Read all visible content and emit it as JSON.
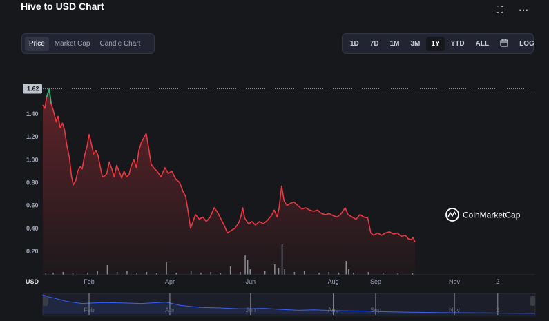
{
  "header": {
    "title": "Hive to USD Chart",
    "fullscreen_icon": "expand-icon",
    "more_icon": "more-horizontal-icon"
  },
  "view_tabs": [
    {
      "label": "Price",
      "active": true
    },
    {
      "label": "Market Cap",
      "active": false
    },
    {
      "label": "Candle Chart",
      "active": false
    }
  ],
  "range_tabs": [
    {
      "label": "1D",
      "active": false
    },
    {
      "label": "7D",
      "active": false
    },
    {
      "label": "1M",
      "active": false
    },
    {
      "label": "3M",
      "active": false
    },
    {
      "label": "1Y",
      "active": true
    },
    {
      "label": "YTD",
      "active": false
    },
    {
      "label": "ALL",
      "active": false
    },
    {
      "label": "",
      "icon": "calendar-icon",
      "active": false
    },
    {
      "label": "LOG",
      "active": false
    }
  ],
  "watermark": "CoinMarketCap",
  "colors": {
    "line": "#ea3943",
    "up_segment": "#16c784",
    "volume": "#8a8d94",
    "navigator": "#3861fb",
    "background": "#17181b"
  },
  "chart_data": {
    "type": "line",
    "unit_label": "USD",
    "ylim": [
      0,
      1.7
    ],
    "yticks": [
      0.2,
      0.4,
      0.6,
      0.8,
      1.0,
      1.2,
      1.4
    ],
    "ytick_labels": [
      "0.20",
      "0.40",
      "0.60",
      "0.80",
      "1.00",
      "1.20",
      "1.40"
    ],
    "current_price_label": "1.62",
    "current_price": 1.62,
    "xlim": [
      0,
      1
    ],
    "xticks": [
      {
        "pos": 0.094,
        "label": "Feb"
      },
      {
        "pos": 0.258,
        "label": "Apr"
      },
      {
        "pos": 0.422,
        "label": "Jun"
      },
      {
        "pos": 0.59,
        "label": "Aug"
      },
      {
        "pos": 0.676,
        "label": "Sep"
      },
      {
        "pos": 0.836,
        "label": "Nov"
      },
      {
        "pos": 0.924,
        "label": "2"
      }
    ],
    "series": [
      {
        "values": [
          [
            0.0,
            1.48
          ],
          [
            0.004,
            1.45
          ],
          [
            0.008,
            1.55
          ],
          [
            0.013,
            1.62
          ],
          [
            0.017,
            1.49
          ],
          [
            0.022,
            1.42
          ],
          [
            0.027,
            1.33
          ],
          [
            0.031,
            1.38
          ],
          [
            0.035,
            1.28
          ],
          [
            0.04,
            1.32
          ],
          [
            0.044,
            1.26
          ],
          [
            0.049,
            1.12
          ],
          [
            0.054,
            1.02
          ],
          [
            0.058,
            0.86
          ],
          [
            0.062,
            0.78
          ],
          [
            0.067,
            0.82
          ],
          [
            0.071,
            0.9
          ],
          [
            0.076,
            0.94
          ],
          [
            0.08,
            0.92
          ],
          [
            0.085,
            1.04
          ],
          [
            0.09,
            1.12
          ],
          [
            0.094,
            1.22
          ],
          [
            0.098,
            1.15
          ],
          [
            0.103,
            1.05
          ],
          [
            0.108,
            1.08
          ],
          [
            0.112,
            1.04
          ],
          [
            0.116,
            0.95
          ],
          [
            0.121,
            0.85
          ],
          [
            0.126,
            0.86
          ],
          [
            0.13,
            0.88
          ],
          [
            0.135,
            0.98
          ],
          [
            0.14,
            0.92
          ],
          [
            0.145,
            0.85
          ],
          [
            0.15,
            0.95
          ],
          [
            0.155,
            0.9
          ],
          [
            0.16,
            0.84
          ],
          [
            0.165,
            0.9
          ],
          [
            0.17,
            0.85
          ],
          [
            0.175,
            0.87
          ],
          [
            0.18,
            0.95
          ],
          [
            0.185,
            1.0
          ],
          [
            0.19,
            0.93
          ],
          [
            0.195,
            1.08
          ],
          [
            0.2,
            1.15
          ],
          [
            0.205,
            1.19
          ],
          [
            0.21,
            1.23
          ],
          [
            0.215,
            1.1
          ],
          [
            0.22,
            0.96
          ],
          [
            0.225,
            0.93
          ],
          [
            0.232,
            0.9
          ],
          [
            0.24,
            0.85
          ],
          [
            0.248,
            0.93
          ],
          [
            0.255,
            0.88
          ],
          [
            0.262,
            0.9
          ],
          [
            0.27,
            0.83
          ],
          [
            0.278,
            0.8
          ],
          [
            0.285,
            0.72
          ],
          [
            0.29,
            0.68
          ],
          [
            0.295,
            0.55
          ],
          [
            0.3,
            0.4
          ],
          [
            0.305,
            0.46
          ],
          [
            0.31,
            0.52
          ],
          [
            0.318,
            0.48
          ],
          [
            0.325,
            0.5
          ],
          [
            0.332,
            0.46
          ],
          [
            0.34,
            0.5
          ],
          [
            0.348,
            0.58
          ],
          [
            0.355,
            0.54
          ],
          [
            0.362,
            0.48
          ],
          [
            0.368,
            0.43
          ],
          [
            0.375,
            0.36
          ],
          [
            0.382,
            0.38
          ],
          [
            0.39,
            0.4
          ],
          [
            0.398,
            0.45
          ],
          [
            0.402,
            0.5
          ],
          [
            0.406,
            0.58
          ],
          [
            0.41,
            0.49
          ],
          [
            0.418,
            0.44
          ],
          [
            0.425,
            0.46
          ],
          [
            0.432,
            0.43
          ],
          [
            0.44,
            0.46
          ],
          [
            0.448,
            0.44
          ],
          [
            0.456,
            0.47
          ],
          [
            0.464,
            0.51
          ],
          [
            0.47,
            0.56
          ],
          [
            0.476,
            0.5
          ],
          [
            0.48,
            0.58
          ],
          [
            0.485,
            0.77
          ],
          [
            0.49,
            0.64
          ],
          [
            0.496,
            0.6
          ],
          [
            0.503,
            0.62
          ],
          [
            0.51,
            0.63
          ],
          [
            0.518,
            0.6
          ],
          [
            0.526,
            0.57
          ],
          [
            0.534,
            0.58
          ],
          [
            0.542,
            0.56
          ],
          [
            0.55,
            0.55
          ],
          [
            0.558,
            0.56
          ],
          [
            0.566,
            0.53
          ],
          [
            0.574,
            0.52
          ],
          [
            0.582,
            0.53
          ],
          [
            0.59,
            0.51
          ],
          [
            0.598,
            0.5
          ],
          [
            0.606,
            0.53
          ],
          [
            0.614,
            0.58
          ],
          [
            0.62,
            0.52
          ],
          [
            0.628,
            0.5
          ],
          [
            0.636,
            0.48
          ],
          [
            0.644,
            0.52
          ],
          [
            0.652,
            0.5
          ],
          [
            0.66,
            0.49
          ],
          [
            0.666,
            0.36
          ],
          [
            0.672,
            0.34
          ],
          [
            0.68,
            0.36
          ],
          [
            0.688,
            0.34
          ],
          [
            0.696,
            0.36
          ],
          [
            0.704,
            0.37
          ],
          [
            0.712,
            0.35
          ],
          [
            0.72,
            0.36
          ],
          [
            0.728,
            0.33
          ],
          [
            0.736,
            0.34
          ],
          [
            0.742,
            0.31
          ],
          [
            0.748,
            0.3
          ],
          [
            0.752,
            0.32
          ],
          [
            0.756,
            0.28
          ]
        ]
      }
    ],
    "volume": [
      [
        0.005,
        2
      ],
      [
        0.02,
        3
      ],
      [
        0.04,
        4
      ],
      [
        0.06,
        2
      ],
      [
        0.09,
        3
      ],
      [
        0.11,
        5
      ],
      [
        0.13,
        14
      ],
      [
        0.15,
        4
      ],
      [
        0.17,
        6
      ],
      [
        0.19,
        3
      ],
      [
        0.21,
        4
      ],
      [
        0.23,
        2
      ],
      [
        0.25,
        18
      ],
      [
        0.27,
        3
      ],
      [
        0.3,
        6
      ],
      [
        0.32,
        3
      ],
      [
        0.34,
        4
      ],
      [
        0.36,
        2
      ],
      [
        0.38,
        12
      ],
      [
        0.4,
        4
      ],
      [
        0.41,
        28
      ],
      [
        0.415,
        22
      ],
      [
        0.42,
        8
      ],
      [
        0.45,
        6
      ],
      [
        0.47,
        15
      ],
      [
        0.478,
        10
      ],
      [
        0.485,
        44
      ],
      [
        0.49,
        8
      ],
      [
        0.51,
        4
      ],
      [
        0.53,
        6
      ],
      [
        0.56,
        3
      ],
      [
        0.58,
        4
      ],
      [
        0.6,
        3
      ],
      [
        0.615,
        20
      ],
      [
        0.62,
        8
      ],
      [
        0.63,
        3
      ],
      [
        0.66,
        4
      ],
      [
        0.69,
        3
      ],
      [
        0.72,
        2
      ],
      [
        0.75,
        2
      ]
    ],
    "navigator": [
      [
        0.0,
        0.95
      ],
      [
        0.02,
        0.85
      ],
      [
        0.05,
        0.65
      ],
      [
        0.08,
        0.55
      ],
      [
        0.12,
        0.6
      ],
      [
        0.16,
        0.58
      ],
      [
        0.2,
        0.55
      ],
      [
        0.25,
        0.62
      ],
      [
        0.28,
        0.45
      ],
      [
        0.32,
        0.35
      ],
      [
        0.36,
        0.32
      ],
      [
        0.4,
        0.28
      ],
      [
        0.45,
        0.3
      ],
      [
        0.48,
        0.25
      ],
      [
        0.52,
        0.2
      ],
      [
        0.55,
        0.22
      ],
      [
        0.6,
        0.18
      ],
      [
        0.65,
        0.16
      ],
      [
        0.7,
        0.12
      ],
      [
        0.75,
        0.1
      ],
      [
        0.8,
        0.08
      ],
      [
        0.85,
        0.07
      ],
      [
        0.9,
        0.06
      ],
      [
        0.95,
        0.05
      ],
      [
        1.0,
        0.04
      ]
    ]
  }
}
